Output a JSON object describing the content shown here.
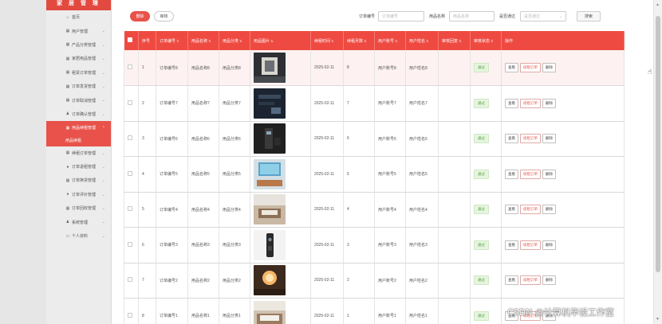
{
  "sidebar": {
    "brand": "家 居 管 理",
    "items": [
      {
        "label": "首页",
        "icon": "home-icon",
        "glyph": "⌂",
        "active": false,
        "chev": false
      },
      {
        "label": "用户管理",
        "icon": "user-icon",
        "glyph": "▦",
        "active": false,
        "chev": true
      },
      {
        "label": "产品分类管理",
        "icon": "grid-icon",
        "glyph": "▦",
        "active": false,
        "chev": true
      },
      {
        "label": "家居用品管理",
        "icon": "tag-icon",
        "glyph": "▦",
        "active": false,
        "chev": true
      },
      {
        "label": "租赁订单管理",
        "icon": "list-icon",
        "glyph": "▦",
        "active": false,
        "chev": true
      },
      {
        "label": "订单发货管理",
        "icon": "grid-icon",
        "glyph": "▦",
        "active": false,
        "chev": true
      },
      {
        "label": "订单取消管理",
        "icon": "grid-icon",
        "glyph": "▦",
        "active": false,
        "chev": true
      },
      {
        "label": "订单确认管理",
        "icon": "user-icon",
        "glyph": "♟",
        "active": false,
        "chev": true
      },
      {
        "label": "用品续租管理",
        "icon": "grid-icon",
        "glyph": "▦",
        "active": true,
        "chev": true
      },
      {
        "label": "续租订单管理",
        "icon": "grid-icon",
        "glyph": "▦",
        "active": false,
        "chev": true
      },
      {
        "label": "订单退租管理",
        "icon": "chat-icon",
        "glyph": "●",
        "active": false,
        "chev": true
      },
      {
        "label": "订单换货管理",
        "icon": "grid-icon",
        "glyph": "▦",
        "active": false,
        "chev": true
      },
      {
        "label": "订单评价管理",
        "icon": "chat-icon",
        "glyph": "●",
        "active": false,
        "chev": true
      },
      {
        "label": "订单回收管理",
        "icon": "grid-icon",
        "glyph": "▦",
        "active": false,
        "chev": true
      },
      {
        "label": "系统管理",
        "icon": "user-icon",
        "glyph": "♟",
        "active": false,
        "chev": true
      },
      {
        "label": "个人资料",
        "icon": "profile-icon",
        "glyph": "▭",
        "active": false,
        "chev": true
      }
    ],
    "sub_item": "用品续租"
  },
  "toolbar": {
    "delete_label": "删除",
    "review_label": "审核",
    "order_no_label": "订单编号",
    "order_no_placeholder": "订单编号",
    "product_name_label": "用品名称",
    "product_name_placeholder": "用品名称",
    "approved_label": "是否通过",
    "approved_placeholder": "是否通过",
    "search_label": "搜索"
  },
  "table": {
    "headers": [
      "序号",
      "订单编号",
      "用品名称",
      "用品分类",
      "用品图片",
      "续租时间",
      "续租月数",
      "用户账号",
      "用户姓名",
      "审核回复",
      "审核状态",
      "操作"
    ],
    "rows": [
      {
        "idx": "1",
        "order": "订单编号8",
        "name": "用品名称8",
        "cat": "用品分类8",
        "img": "img-1",
        "date": "2025-02-11",
        "months": "8",
        "account": "用户账号8",
        "uname": "用户姓名8",
        "status": "通过"
      },
      {
        "idx": "2",
        "order": "订单编号7",
        "name": "用品名称7",
        "cat": "用品分类7",
        "img": "img-2",
        "date": "2025-02-11",
        "months": "7",
        "account": "用户账号7",
        "uname": "用户姓名7",
        "status": "通过"
      },
      {
        "idx": "3",
        "order": "订单编号6",
        "name": "用品名称6",
        "cat": "用品分类6",
        "img": "img-3",
        "date": "2025-02-11",
        "months": "6",
        "account": "用户账号6",
        "uname": "用户姓名6",
        "status": "通过"
      },
      {
        "idx": "4",
        "order": "订单编号5",
        "name": "用品名称5",
        "cat": "用品分类5",
        "img": "img-4",
        "date": "2025-02-11",
        "months": "5",
        "account": "用户账号5",
        "uname": "用户姓名5",
        "status": "通过"
      },
      {
        "idx": "5",
        "order": "订单编号4",
        "name": "用品名称4",
        "cat": "用品分类4",
        "img": "img-5",
        "date": "2025-02-11",
        "months": "4",
        "account": "用户账号4",
        "uname": "用户姓名4",
        "status": "通过"
      },
      {
        "idx": "6",
        "order": "订单编号3",
        "name": "用品名称3",
        "cat": "用品分类3",
        "img": "img-6",
        "date": "2025-02-11",
        "months": "3",
        "account": "用户账号3",
        "uname": "用户姓名3",
        "status": "通过"
      },
      {
        "idx": "7",
        "order": "订单编号2",
        "name": "用品名称2",
        "cat": "用品分类2",
        "img": "img-7",
        "date": "2025-02-11",
        "months": "2",
        "account": "用户账号2",
        "uname": "用户姓名2",
        "status": "通过"
      },
      {
        "idx": "8",
        "order": "订单编号1",
        "name": "用品名称1",
        "cat": "用品分类1",
        "img": "img-8",
        "date": "2025-02-11",
        "months": "1",
        "account": "用户账号1",
        "uname": "用户姓名1",
        "status": "通过"
      }
    ],
    "actions": {
      "view": "查看",
      "renew_order": "续租订单",
      "delete": "删除"
    }
  },
  "colors": {
    "accent": "#e8524a",
    "header": "#ef4a41",
    "badge_bg": "#e5f5e0",
    "badge_fg": "#5a9e3e"
  },
  "watermark": "CSDN @计算机毕设工作室"
}
